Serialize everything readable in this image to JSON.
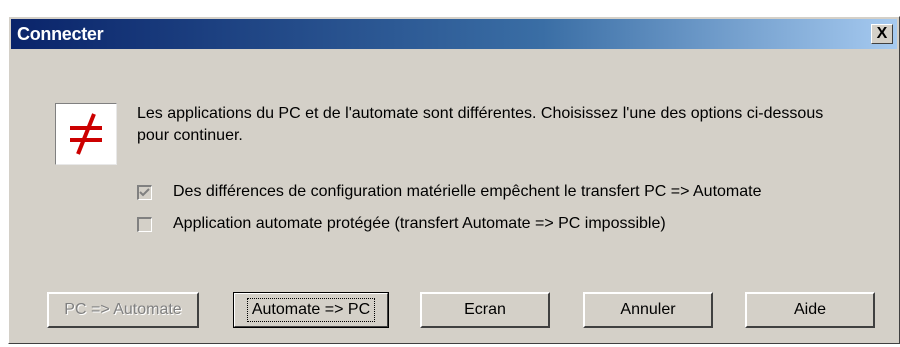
{
  "window": {
    "title": "Connecter",
    "close_label": "X"
  },
  "icon": {
    "name": "not-equal-icon",
    "color": "#cc0000"
  },
  "message": "Les applications du PC et de l'automate sont différentes. Choisissez l'une des options ci-dessous pour continuer.",
  "checks": [
    {
      "label": "Des différences de configuration matérielle empêchent le transfert PC => Automate",
      "checked": true,
      "enabled": false
    },
    {
      "label": "Application automate protégée (transfert Automate => PC impossible)",
      "checked": false,
      "enabled": false
    }
  ],
  "buttons": {
    "pc_to_plc": "PC => Automate",
    "plc_to_pc": "Automate => PC",
    "screen": "Ecran",
    "cancel": "Annuler",
    "help": "Aide"
  },
  "colors": {
    "title_bar": "#0a246a",
    "dialog_bg": "#d4d0c8"
  }
}
